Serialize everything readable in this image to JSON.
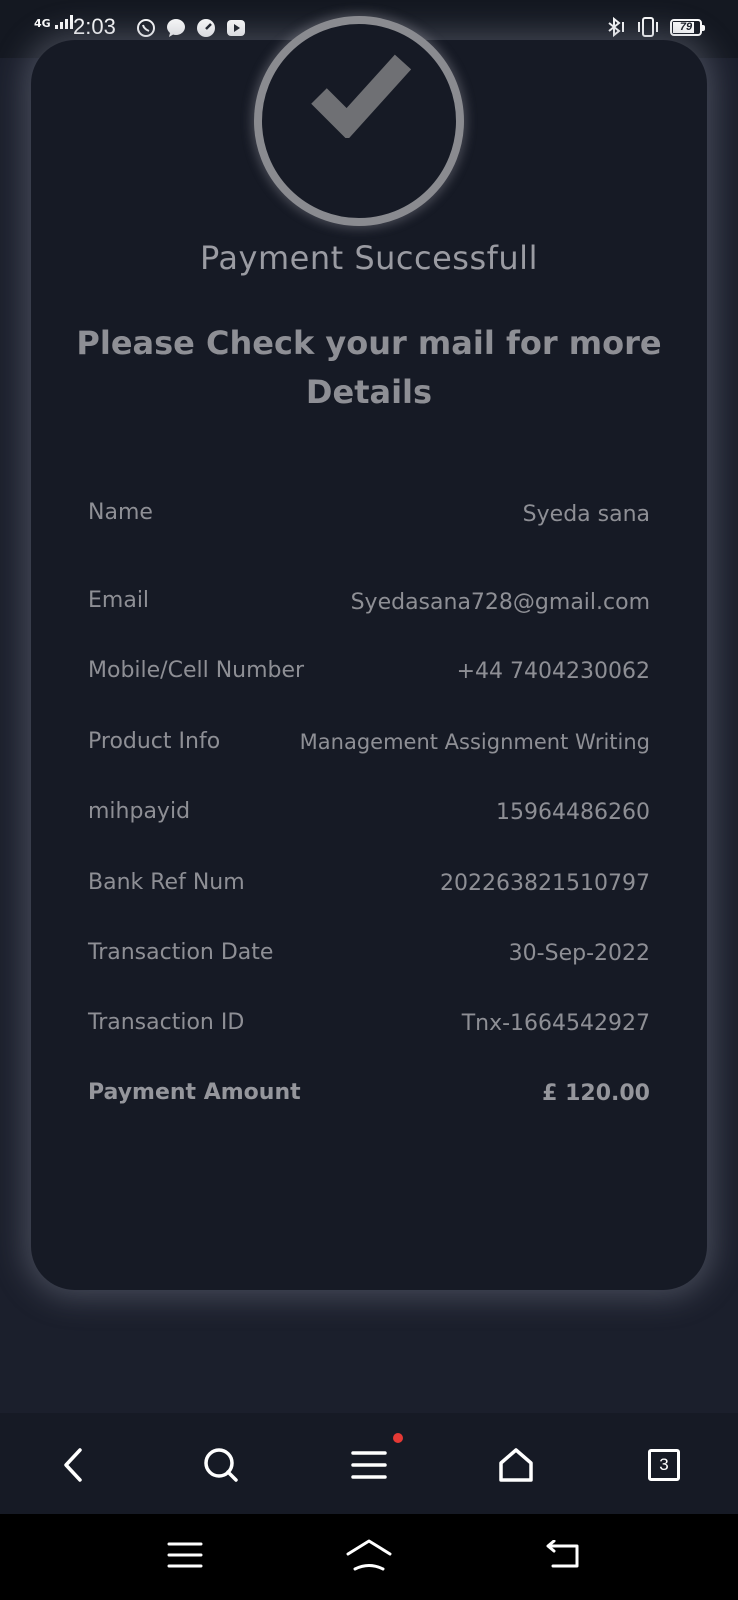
{
  "status_bar": {
    "network": "4G",
    "time": "2:03",
    "battery": "79",
    "battery_level": 0.79,
    "app_icons": [
      "whatsapp-icon",
      "message-icon",
      "speedometer-icon",
      "youtube-icon"
    ],
    "system_icons": [
      "bluetooth-icon",
      "vibrate-icon",
      "battery-icon"
    ]
  },
  "card": {
    "title": "Payment Successfull",
    "subtitle": "Please Check your mail for more Details",
    "details": [
      {
        "label": "Name",
        "value": "Syeda sana"
      },
      {
        "label": "Email",
        "value": "Syedasana728@gmail.com"
      },
      {
        "label": "Mobile/Cell Number",
        "value": "+44 7404230062"
      },
      {
        "label": "Product Info",
        "value": "Management Assignment Writing"
      },
      {
        "label": "mihpayid",
        "value": "15964486260"
      },
      {
        "label": "Bank Ref Num",
        "value": "202263821510797"
      },
      {
        "label": "Transaction Date",
        "value": "30-Sep-2022"
      },
      {
        "label": "Transaction ID",
        "value": "Tnx-1664542927"
      },
      {
        "label": "Payment Amount",
        "value": "£ 120.00"
      }
    ]
  },
  "browser_toolbar": {
    "tabs_count": "3",
    "icons": [
      "back-icon",
      "search-icon",
      "menu-icon",
      "home-icon",
      "tabs-icon"
    ]
  },
  "system_nav": {
    "icons": [
      "recents-icon",
      "home-icon",
      "back-icon"
    ]
  },
  "colors": {
    "background": "#1b1f2c",
    "card": "#161a25",
    "text": "#8e8f95",
    "accent_dot": "#e53935"
  }
}
